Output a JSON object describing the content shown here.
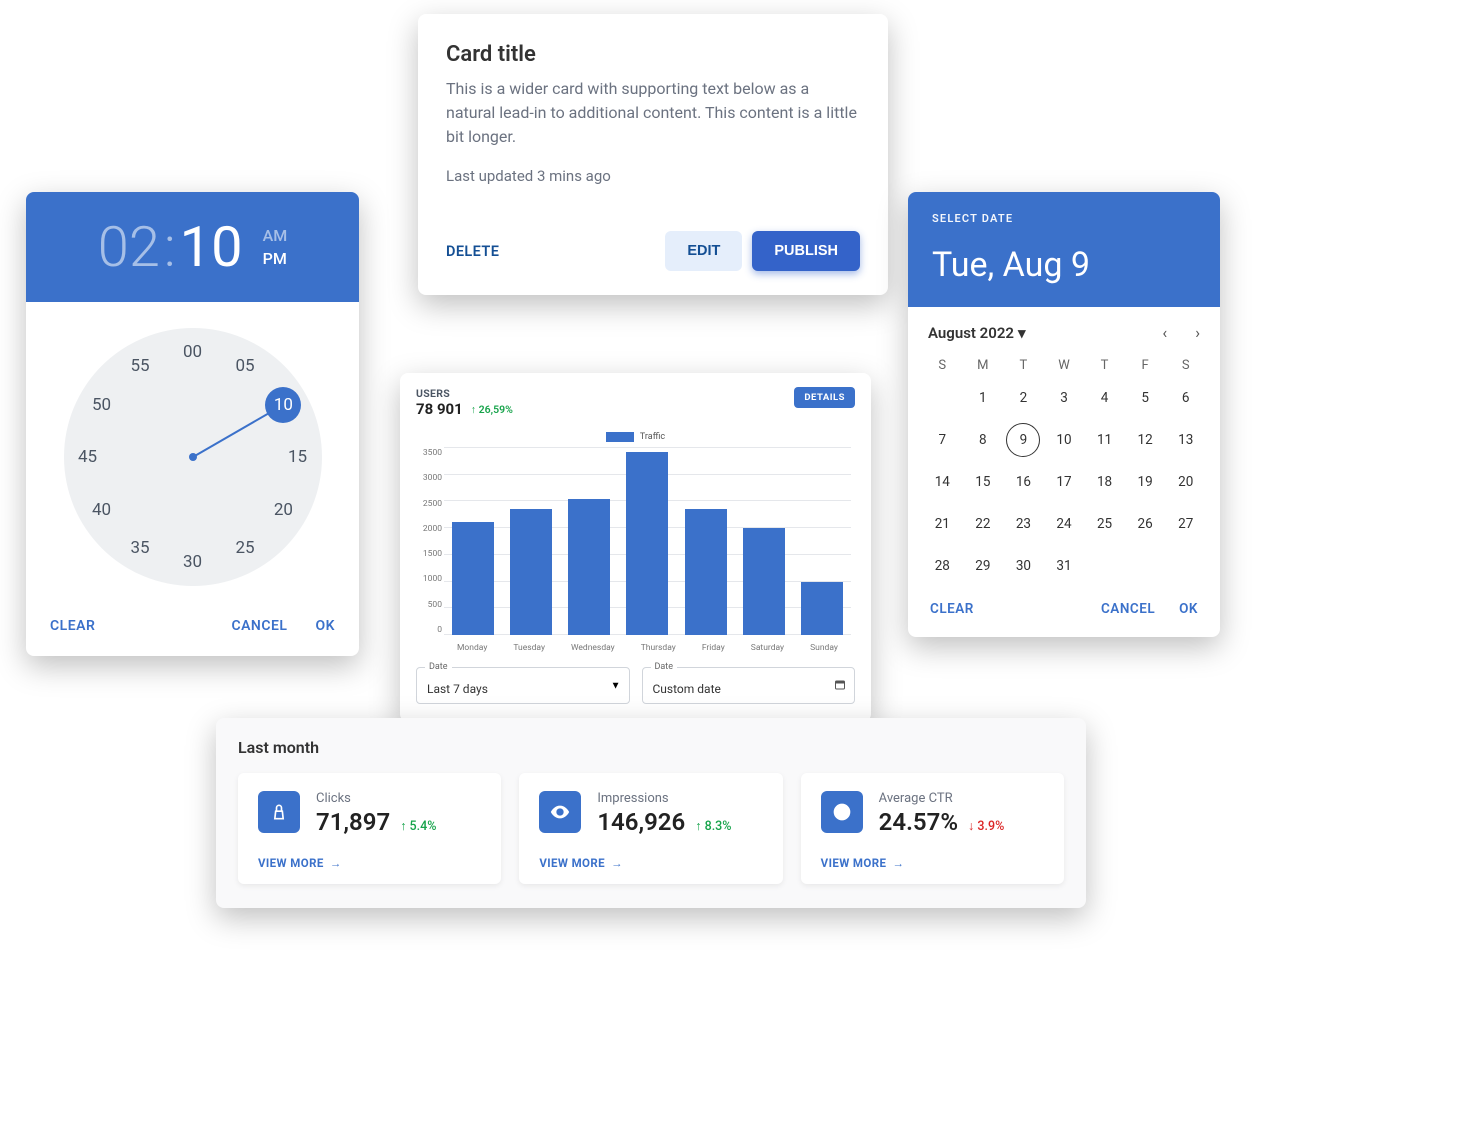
{
  "title_card": {
    "heading": "Card title",
    "body": "This is a wider card with supporting text below as a natural lead-in to additional content. This content is a little bit longer.",
    "updated": "Last updated 3 mins ago",
    "delete_label": "DELETE",
    "edit_label": "EDIT",
    "publish_label": "PUBLISH"
  },
  "time_picker": {
    "hour": "02",
    "minute": "10",
    "am_label": "AM",
    "pm_label": "PM",
    "active_period": "PM",
    "minutes": [
      "00",
      "05",
      "10",
      "15",
      "20",
      "25",
      "30",
      "35",
      "40",
      "45",
      "50",
      "55"
    ],
    "selected_minute": "10",
    "clear": "CLEAR",
    "cancel": "CANCEL",
    "ok": "OK"
  },
  "chart_card": {
    "header_label": "USERS",
    "header_value": "78 901",
    "header_delta": "↑ 26,59%",
    "details": "DETAILS",
    "legend": "Traffic",
    "date_label": "Date",
    "range_value": "Last 7 days",
    "custom_value": "Custom date"
  },
  "chart_data": {
    "type": "bar",
    "categories": [
      "Monday",
      "Tuesday",
      "Wednesday",
      "Thursday",
      "Friday",
      "Saturday",
      "Sunday"
    ],
    "values": [
      2120,
      2350,
      2550,
      3420,
      2350,
      2000,
      1000
    ],
    "series_name": "Traffic",
    "ylabel": "",
    "xlabel": "",
    "ylim": [
      0,
      3500
    ],
    "y_ticks": [
      0,
      500,
      1000,
      1500,
      2000,
      2500,
      3000,
      3500
    ],
    "title": "USERS"
  },
  "date_picker": {
    "select_label": "SELECT DATE",
    "picked": "Tue, Aug 9",
    "month_label": "August 2022",
    "dow": [
      "S",
      "M",
      "T",
      "W",
      "T",
      "F",
      "S"
    ],
    "first_day_offset": 1,
    "days_in_month": 31,
    "selected_day": 9,
    "clear": "CLEAR",
    "cancel": "CANCEL",
    "ok": "OK"
  },
  "stats": {
    "heading": "Last month",
    "view_more": "VIEW MORE",
    "items": [
      {
        "label": "Clicks",
        "value": "71,897",
        "delta": "↑ 5.4%",
        "dir": "up"
      },
      {
        "label": "Impressions",
        "value": "146,926",
        "delta": "↑ 8.3%",
        "dir": "up"
      },
      {
        "label": "Average CTR",
        "value": "24.57%",
        "delta": "↓ 3.9%",
        "dir": "down"
      }
    ]
  }
}
